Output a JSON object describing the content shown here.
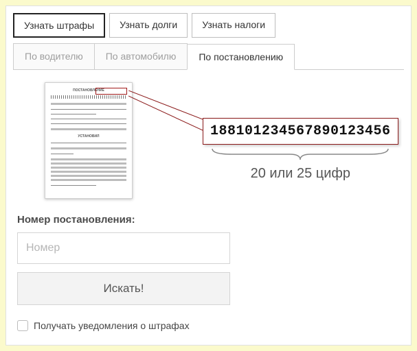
{
  "top_tabs": {
    "fines": "Узнать штрафы",
    "debts": "Узнать долги",
    "taxes": "Узнать налоги"
  },
  "sub_tabs": {
    "by_driver": "По водителю",
    "by_car": "По автомобилю",
    "by_decree": "По постановлению"
  },
  "callout": {
    "sample_number": "188101234567890123456",
    "hint": "20 или 25 цифр"
  },
  "form": {
    "label": "Номер постановления:",
    "placeholder": "Номер",
    "search": "Искать!",
    "notify": "Получать уведомления о штрафах"
  }
}
